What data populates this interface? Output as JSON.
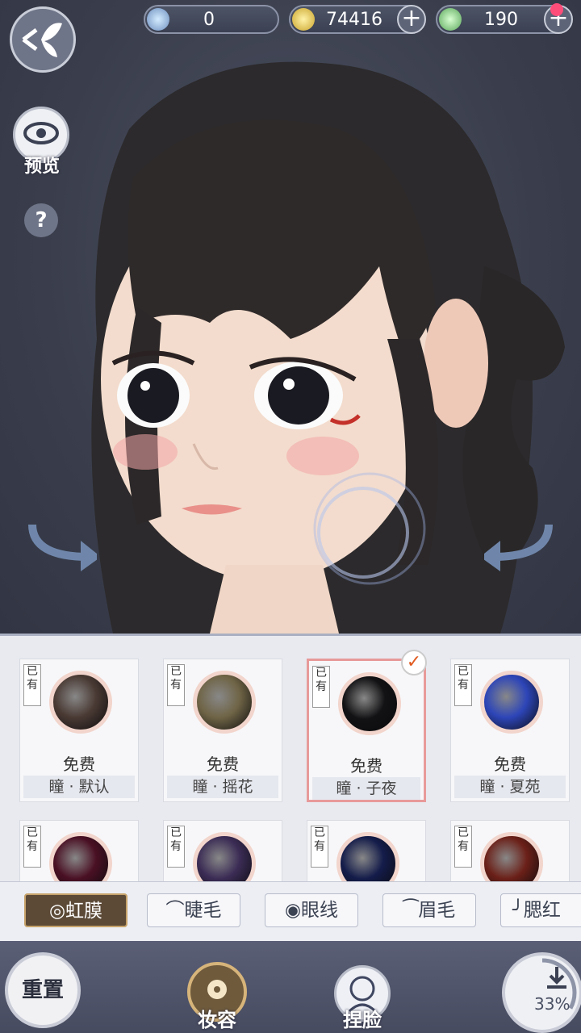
{
  "currency": [
    {
      "icon": "jade-icon",
      "value": "0",
      "has_plus": false
    },
    {
      "icon": "coin-icon",
      "value": "74416",
      "has_plus": true
    },
    {
      "icon": "spirit-icon",
      "value": "190",
      "has_plus": true
    }
  ],
  "left": {
    "preview_label": "预览",
    "help_label": "?"
  },
  "items": [
    {
      "owned": "已有",
      "price": "免费",
      "name": "瞳 · 默认",
      "color": "#4a3a34",
      "selected": false
    },
    {
      "owned": "已有",
      "price": "免费",
      "name": "瞳 · 摇花",
      "color": "#6f6446",
      "selected": false
    },
    {
      "owned": "已有",
      "price": "免费",
      "name": "瞳 · 子夜",
      "color": "#121214",
      "selected": true
    },
    {
      "owned": "已有",
      "price": "免费",
      "name": "瞳 · 夏苑",
      "color": "#2d45b8",
      "selected": false
    },
    {
      "owned": "已有",
      "color": "#4a1024"
    },
    {
      "owned": "已有",
      "color": "#3b2c55"
    },
    {
      "owned": "已有",
      "color": "#141c4a"
    },
    {
      "owned": "已有",
      "color": "#6b2018"
    }
  ],
  "tabs": [
    {
      "label": "虹膜",
      "icon": "circle-icon",
      "active": true
    },
    {
      "label": "睫毛",
      "icon": "lash-icon",
      "active": false
    },
    {
      "label": "眼线",
      "icon": "eye-icon",
      "active": false
    },
    {
      "label": "眉毛",
      "icon": "brow-icon",
      "active": false
    },
    {
      "label": "腮红",
      "icon": "blush-icon",
      "active": false
    }
  ],
  "bottom": {
    "reset_label": "重置",
    "makeup_label": "妆容",
    "face_label": "捏脸",
    "save_progress": "33%"
  }
}
